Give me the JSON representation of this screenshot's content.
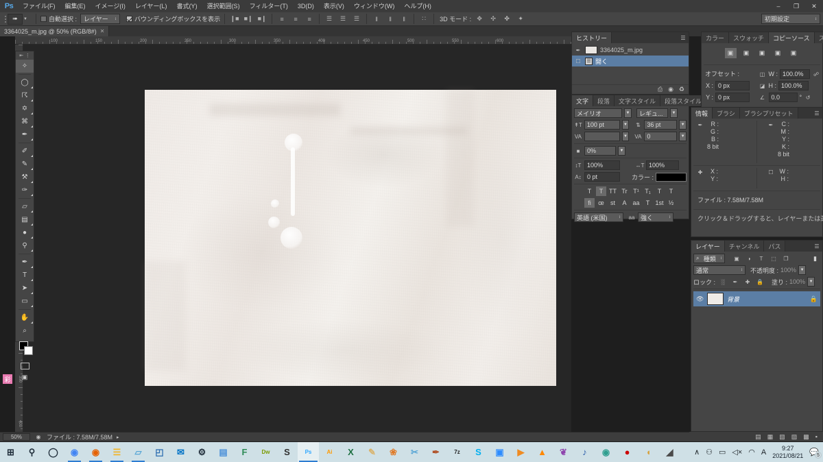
{
  "app": {
    "name": "Adobe Photoshop",
    "logo": "Ps"
  },
  "menubar": {
    "items": [
      "ファイル(F)",
      "編集(E)",
      "イメージ(I)",
      "レイヤー(L)",
      "書式(Y)",
      "選択範囲(S)",
      "フィルター(T)",
      "3D(D)",
      "表示(V)",
      "ウィンドウ(W)",
      "ヘルプ(H)"
    ],
    "window_buttons": [
      "–",
      "❐",
      "✕"
    ]
  },
  "options_bar": {
    "tool_icon": "move-tool",
    "auto_select_label": "自動選択 :",
    "auto_select_checked": false,
    "layer_select_value": "レイヤー",
    "bounding_box_label": "バウンディングボックスを表示",
    "bounding_box_checked": true,
    "align_group_1": [
      "❙■",
      "■❙",
      "■❙"
    ],
    "align_group_2": [
      "≡",
      "≡",
      "≡"
    ],
    "align_group_3": [
      "☰",
      "☰",
      "☰"
    ],
    "align_group_4": [
      "‖",
      "‖",
      "‖"
    ],
    "align_group_5": [
      "∷"
    ],
    "mode_3d_label": "3D モード :",
    "workspace_value": "初期設定"
  },
  "document_tab": {
    "title": "3364025_m.jpg @ 50% (RGB/8#)",
    "close": "✕"
  },
  "rulers": {
    "h_labels": [
      "100",
      "150",
      "200",
      "250",
      "300",
      "350",
      "400",
      "450",
      "500",
      "550",
      "600"
    ],
    "v_labels": [
      "0",
      "50",
      "100",
      "150",
      "200",
      "250",
      "300",
      "350",
      "400"
    ]
  },
  "toolbar": {
    "tools": [
      {
        "name": "move-tool",
        "glyph": "✧",
        "selected": true,
        "sub": false
      },
      {
        "name": "elliptical-marquee-tool",
        "glyph": "◯",
        "selected": false,
        "sub": true
      },
      {
        "name": "lasso-tool",
        "glyph": "☈",
        "selected": false,
        "sub": true
      },
      {
        "name": "magic-wand-tool",
        "glyph": "✡",
        "selected": false,
        "sub": true
      },
      {
        "name": "crop-tool",
        "glyph": "⌘",
        "selected": false,
        "sub": true
      },
      {
        "name": "eyedropper-tool",
        "glyph": "✒",
        "selected": false,
        "sub": true
      },
      {
        "name": "healing-brush-tool",
        "glyph": "✐",
        "selected": false,
        "sub": true
      },
      {
        "name": "brush-tool",
        "glyph": "✎",
        "selected": false,
        "sub": true
      },
      {
        "name": "clone-stamp-tool",
        "glyph": "⚒",
        "selected": false,
        "sub": true
      },
      {
        "name": "history-brush-tool",
        "glyph": "✑",
        "selected": false,
        "sub": true
      },
      {
        "name": "eraser-tool",
        "glyph": "▱",
        "selected": false,
        "sub": true
      },
      {
        "name": "gradient-tool",
        "glyph": "▤",
        "selected": false,
        "sub": true
      },
      {
        "name": "blur-tool",
        "glyph": "●",
        "selected": false,
        "sub": true
      },
      {
        "name": "dodge-tool",
        "glyph": "⚲",
        "selected": false,
        "sub": true
      },
      {
        "name": "pen-tool",
        "glyph": "✒",
        "selected": false,
        "sub": true
      },
      {
        "name": "type-tool",
        "glyph": "T",
        "selected": false,
        "sub": true
      },
      {
        "name": "path-selection-tool",
        "glyph": "➤",
        "selected": false,
        "sub": true
      },
      {
        "name": "rectangle-tool",
        "glyph": "▭",
        "selected": false,
        "sub": true
      },
      {
        "name": "hand-tool",
        "glyph": "✋",
        "selected": false,
        "sub": true
      },
      {
        "name": "zoom-tool",
        "glyph": "⌕",
        "selected": false,
        "sub": false
      }
    ],
    "foreground_color": "#000000",
    "background_color": "#ffffff",
    "quick_mask_name": "quick-mask-mode",
    "screen_mode_name": "screen-mode",
    "pink_tool_glyph": "彩"
  },
  "history_panel": {
    "tabs": [
      {
        "label": "ヒストリー",
        "active": true
      }
    ],
    "entries": [
      {
        "name": "3364025_m.jpg",
        "selected": false,
        "type": "snapshot"
      },
      {
        "name": "開く",
        "selected": true,
        "type": "state"
      }
    ],
    "footer_icons": [
      "new-document-icon",
      "new-snapshot-icon",
      "delete-icon"
    ]
  },
  "character_panel": {
    "tabs": [
      {
        "label": "文字",
        "active": true
      },
      {
        "label": "段落",
        "active": false
      },
      {
        "label": "文字スタイル",
        "active": false
      },
      {
        "label": "段落スタイル",
        "active": false
      }
    ],
    "font_family": "メイリオ",
    "font_style": "レギュ...",
    "font_size_icon": "font-size-icon",
    "font_size": "100 pt",
    "leading_icon": "leading-icon",
    "leading": "36 pt",
    "kerning_icon": "kerning-icon",
    "kerning": "",
    "tracking_icon": "tracking-icon",
    "tracking": "0",
    "tsume_icon": "tsume-icon",
    "tsume": "0%",
    "vertical_scale_icon": "vertical-scale-icon",
    "vertical_scale": "100%",
    "horizontal_scale_icon": "horizontal-scale-icon",
    "horizontal_scale": "100%",
    "baseline_icon": "baseline-shift-icon",
    "baseline_shift": "0 pt",
    "color_label": "カラー :",
    "color_value": "#000000",
    "style_buttons_row1": [
      "T",
      "T",
      "TT",
      "Tr",
      "T¹",
      "T₁",
      "T",
      "T"
    ],
    "style_buttons_row2": [
      "fi",
      "œ",
      "st",
      "A",
      "aa",
      "T",
      "1st",
      "½"
    ],
    "style_row1_active_index": 1,
    "style_row2_active_index": 0,
    "language": "英語 (米国)",
    "antialias_icon": "anti-alias-icon",
    "antialias": "強く"
  },
  "clone_source_panel": {
    "tabs": [
      {
        "label": "カラー",
        "active": false
      },
      {
        "label": "スウォッチ",
        "active": false
      },
      {
        "label": "コピーソース",
        "active": true
      },
      {
        "label": "スタイル",
        "active": false
      }
    ],
    "source_buttons": 5,
    "source_active_index": 0,
    "offset_label": "オフセット :",
    "offset_x_label": "X :",
    "offset_x": "0 px",
    "offset_y_label": "Y :",
    "offset_y": "0 px",
    "w_label": "W :",
    "w_value": "100.0%",
    "h_label": "H :",
    "h_value": "100.0%",
    "angle_label": "∠",
    "angle_value": "0.0",
    "angle_unit": "°",
    "reset_icon": "reset-icon",
    "link_icon": "link-icon"
  },
  "info_panel": {
    "tabs": [
      {
        "label": "情報",
        "active": true
      },
      {
        "label": "ブラシ",
        "active": false
      },
      {
        "label": "ブラシプリセット",
        "active": false
      }
    ],
    "left_channels": [
      "R :",
      "G :",
      "B :"
    ],
    "left_depth": "8 bit",
    "right_channels": [
      "C :",
      "M :",
      "Y :",
      "K :"
    ],
    "right_depth": "8 bit",
    "coord_labels": [
      "X :",
      "Y :"
    ],
    "size_labels": [
      "W :",
      "H :"
    ],
    "file_line": "ファイル : 7.58M/7.58M",
    "hint": "クリック＆ドラッグすると、レイヤーまたは選択範囲を移動します。Shift、Alt で機能拡張。"
  },
  "layers_panel": {
    "tabs": [
      {
        "label": "レイヤー",
        "active": true
      },
      {
        "label": "チャンネル",
        "active": false
      },
      {
        "label": "パス",
        "active": false
      }
    ],
    "filter_label": "種類",
    "filter_icons": [
      "pixel-filter-icon",
      "adjustment-filter-icon",
      "type-filter-icon",
      "shape-filter-icon",
      "smart-object-filter-icon"
    ],
    "blend_mode": "通常",
    "opacity_label": "不透明度 :",
    "opacity_value": "100%",
    "lock_label": "ロック :",
    "lock_icons": [
      "lock-transparent-icon",
      "lock-image-icon",
      "lock-position-icon",
      "lock-all-icon"
    ],
    "fill_label": "塗り :",
    "fill_value": "100%",
    "layers": [
      {
        "name": "背景",
        "visible": true,
        "locked": true,
        "selected": true
      }
    ]
  },
  "status_bar": {
    "zoom": "50%",
    "doc_icon": "document-icon",
    "file_info": "ファイル : 7.58M/7.58M",
    "arrow": "▸"
  },
  "dock_strip": {
    "icons": [
      "panel-icon-1",
      "panel-icon-2",
      "panel-icon-3",
      "panel-icon-4",
      "panel-icon-5",
      "panel-icon-6"
    ]
  },
  "taskbar": {
    "left_icons": [
      {
        "name": "start-button",
        "glyph": "⊞",
        "color": "#1f2d3a",
        "running": false,
        "active": false
      },
      {
        "name": "search-icon",
        "glyph": "⚲",
        "color": "#1f2d3a",
        "running": false,
        "active": false
      },
      {
        "name": "cortana-icon",
        "glyph": "◯",
        "color": "#1f2d3a",
        "running": false,
        "active": false
      },
      {
        "name": "chrome-icon",
        "glyph": "◉",
        "color": "#4285f4",
        "running": true,
        "active": false
      },
      {
        "name": "firefox-icon",
        "glyph": "◉",
        "color": "#e66000",
        "running": true,
        "active": false
      },
      {
        "name": "file-explorer-icon",
        "glyph": "☰",
        "color": "#f0b429",
        "running": true,
        "active": false
      },
      {
        "name": "notebook-icon",
        "glyph": "▱",
        "color": "#5aa7d6",
        "running": true,
        "active": false
      },
      {
        "name": "photos-icon",
        "glyph": "◰",
        "color": "#2b6cb0",
        "running": false,
        "active": false
      },
      {
        "name": "outlook-icon",
        "glyph": "✉",
        "color": "#0072c6",
        "running": false,
        "active": false
      },
      {
        "name": "settings-icon",
        "glyph": "⚙",
        "color": "#1f2d3a",
        "running": false,
        "active": false
      },
      {
        "name": "contacts-icon",
        "glyph": "▤",
        "color": "#4a90d9",
        "running": false,
        "active": false
      },
      {
        "name": "ffftp-icon",
        "glyph": "F",
        "color": "#2e8b57",
        "running": false,
        "active": false
      },
      {
        "name": "dreamweaver-icon",
        "glyph": "Dw",
        "color": "#7a9a01",
        "running": false,
        "active": false
      },
      {
        "name": "sublime-text-icon",
        "glyph": "S",
        "color": "#2f2f2f",
        "running": false,
        "active": false
      },
      {
        "name": "photoshop-icon",
        "glyph": "Ps",
        "color": "#31a8ff",
        "running": false,
        "active": true
      },
      {
        "name": "illustrator-icon",
        "glyph": "Ai",
        "color": "#ff9a00",
        "running": false,
        "active": false
      },
      {
        "name": "excel-icon",
        "glyph": "X",
        "color": "#1d6f42",
        "running": false,
        "active": false
      },
      {
        "name": "eraser-app-icon",
        "glyph": "✎",
        "color": "#d9b36c",
        "running": false,
        "active": false
      },
      {
        "name": "butterfly-icon",
        "glyph": "❀",
        "color": "#e07b28",
        "running": false,
        "active": false
      },
      {
        "name": "scissors-icon",
        "glyph": "✂",
        "color": "#5aa7d6",
        "running": false,
        "active": false
      },
      {
        "name": "paint-icon",
        "glyph": "✒",
        "color": "#b0532a",
        "running": false,
        "active": false
      },
      {
        "name": "sevenzip-icon",
        "glyph": "7z",
        "color": "#222222",
        "running": false,
        "active": false
      },
      {
        "name": "skype-icon",
        "glyph": "S",
        "color": "#00aff0",
        "running": false,
        "active": false
      },
      {
        "name": "zoom-app-icon",
        "glyph": "▣",
        "color": "#2d8cff",
        "running": false,
        "active": false
      },
      {
        "name": "media-player-icon",
        "glyph": "▶",
        "color": "#ef8b22",
        "running": false,
        "active": false
      },
      {
        "name": "vlc-icon",
        "glyph": "▲",
        "color": "#ff8800",
        "running": false,
        "active": false
      },
      {
        "name": "rabbit-icon",
        "glyph": "❦",
        "color": "#8e44ad",
        "running": false,
        "active": false
      },
      {
        "name": "music-icon",
        "glyph": "♪",
        "color": "#2a5caa",
        "running": false,
        "active": false
      },
      {
        "name": "green-seal-icon",
        "glyph": "◉",
        "color": "#2e9e8f",
        "running": false,
        "active": false
      },
      {
        "name": "record-icon",
        "glyph": "●",
        "color": "#cc0000",
        "running": false,
        "active": false
      },
      {
        "name": "bear-icon",
        "glyph": "◖",
        "color": "#d7a13b",
        "running": false,
        "active": false
      },
      {
        "name": "note-icon",
        "glyph": "◢",
        "color": "#4a4a4a",
        "running": false,
        "active": false
      }
    ],
    "tray_icons": [
      {
        "name": "show-hidden-icons",
        "glyph": "∧"
      },
      {
        "name": "headset-icon",
        "glyph": "⚇"
      },
      {
        "name": "battery-icon",
        "glyph": "▭"
      },
      {
        "name": "volume-muted-icon",
        "glyph": "◁×"
      },
      {
        "name": "wifi-icon",
        "glyph": "◠"
      },
      {
        "name": "ime-icon",
        "glyph": "A"
      }
    ],
    "clock_time": "9:27",
    "clock_date": "2021/08/21",
    "notification_icon": "notification-icon",
    "notification_count": "5"
  }
}
